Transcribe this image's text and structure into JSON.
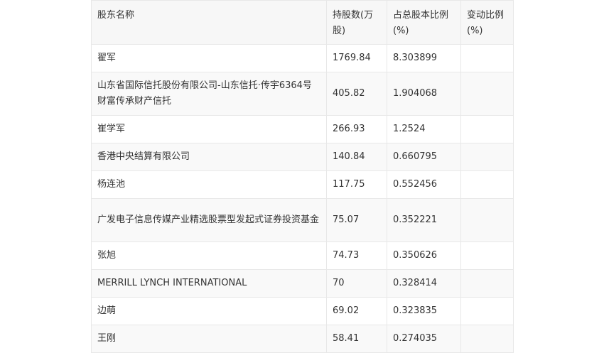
{
  "table": {
    "headers": [
      "股东名称",
      "持股数(万股)",
      "占总股本比例(%)",
      "变动比例(%)"
    ],
    "rows": [
      [
        "翟军",
        "1769.84",
        "8.303899",
        ""
      ],
      [
        "山东省国际信托股份有限公司-山东信托·传宇6364号财富传承财产信托",
        "405.82",
        "1.904068",
        ""
      ],
      [
        "崔学军",
        "266.93",
        "1.2524",
        ""
      ],
      [
        "香港中央结算有限公司",
        "140.84",
        "0.660795",
        ""
      ],
      [
        "杨连池",
        "117.75",
        "0.552456",
        ""
      ],
      [
        "广发电子信息传媒产业精选股票型发起式证券投资基金",
        "75.07",
        "0.352221",
        ""
      ],
      [
        "张旭",
        "74.73",
        "0.350626",
        ""
      ],
      [
        "MERRILL LYNCH INTERNATIONAL",
        "70",
        "0.328414",
        ""
      ],
      [
        "边萌",
        "69.02",
        "0.323835",
        ""
      ],
      [
        "王刚",
        "58.41",
        "0.274035",
        ""
      ]
    ]
  }
}
